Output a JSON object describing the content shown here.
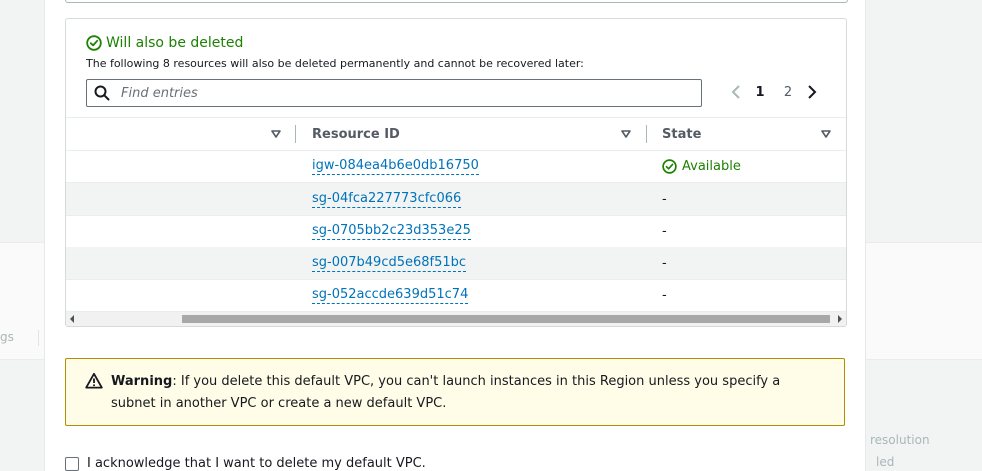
{
  "background": {
    "frag_left": "gs",
    "frag_right_1": "resolution",
    "frag_right_2": "led"
  },
  "panel": {
    "title": "Will also be deleted",
    "description": "The following 8 resources will also be deleted permanently and cannot be recovered later:",
    "search_placeholder": "Find entries",
    "pagination": {
      "pages": [
        "1",
        "2"
      ],
      "current": "1"
    },
    "columns": [
      "",
      "Resource ID",
      "State"
    ],
    "rows": [
      {
        "id": "igw-084ea4b6e0db16750",
        "state": "Available"
      },
      {
        "id": "sg-04fca227773cfc066",
        "state": "-"
      },
      {
        "id": "sg-0705bb2c23d353e25",
        "state": "-"
      },
      {
        "id": "sg-007b49cd5e68f51bc",
        "state": "-"
      },
      {
        "id": "sg-052accde639d51c74",
        "state": "-"
      }
    ]
  },
  "warning": {
    "label": "Warning",
    "text": ": If you delete this default VPC, you can't launch instances in this Region unless you specify a subnet in another VPC or create a new default VPC."
  },
  "acknowledge": {
    "label": "I acknowledge that I want to delete my default VPC."
  },
  "colors": {
    "success": "#1d8102",
    "link": "#0073bb",
    "warning_border": "#b68c00",
    "warning_bg": "#fffce8"
  },
  "icons": {
    "title_icon": "check-circle-icon",
    "search_icon": "search-icon",
    "state_ok_icon": "check-circle-icon",
    "warning_icon": "warning-triangle-icon"
  }
}
